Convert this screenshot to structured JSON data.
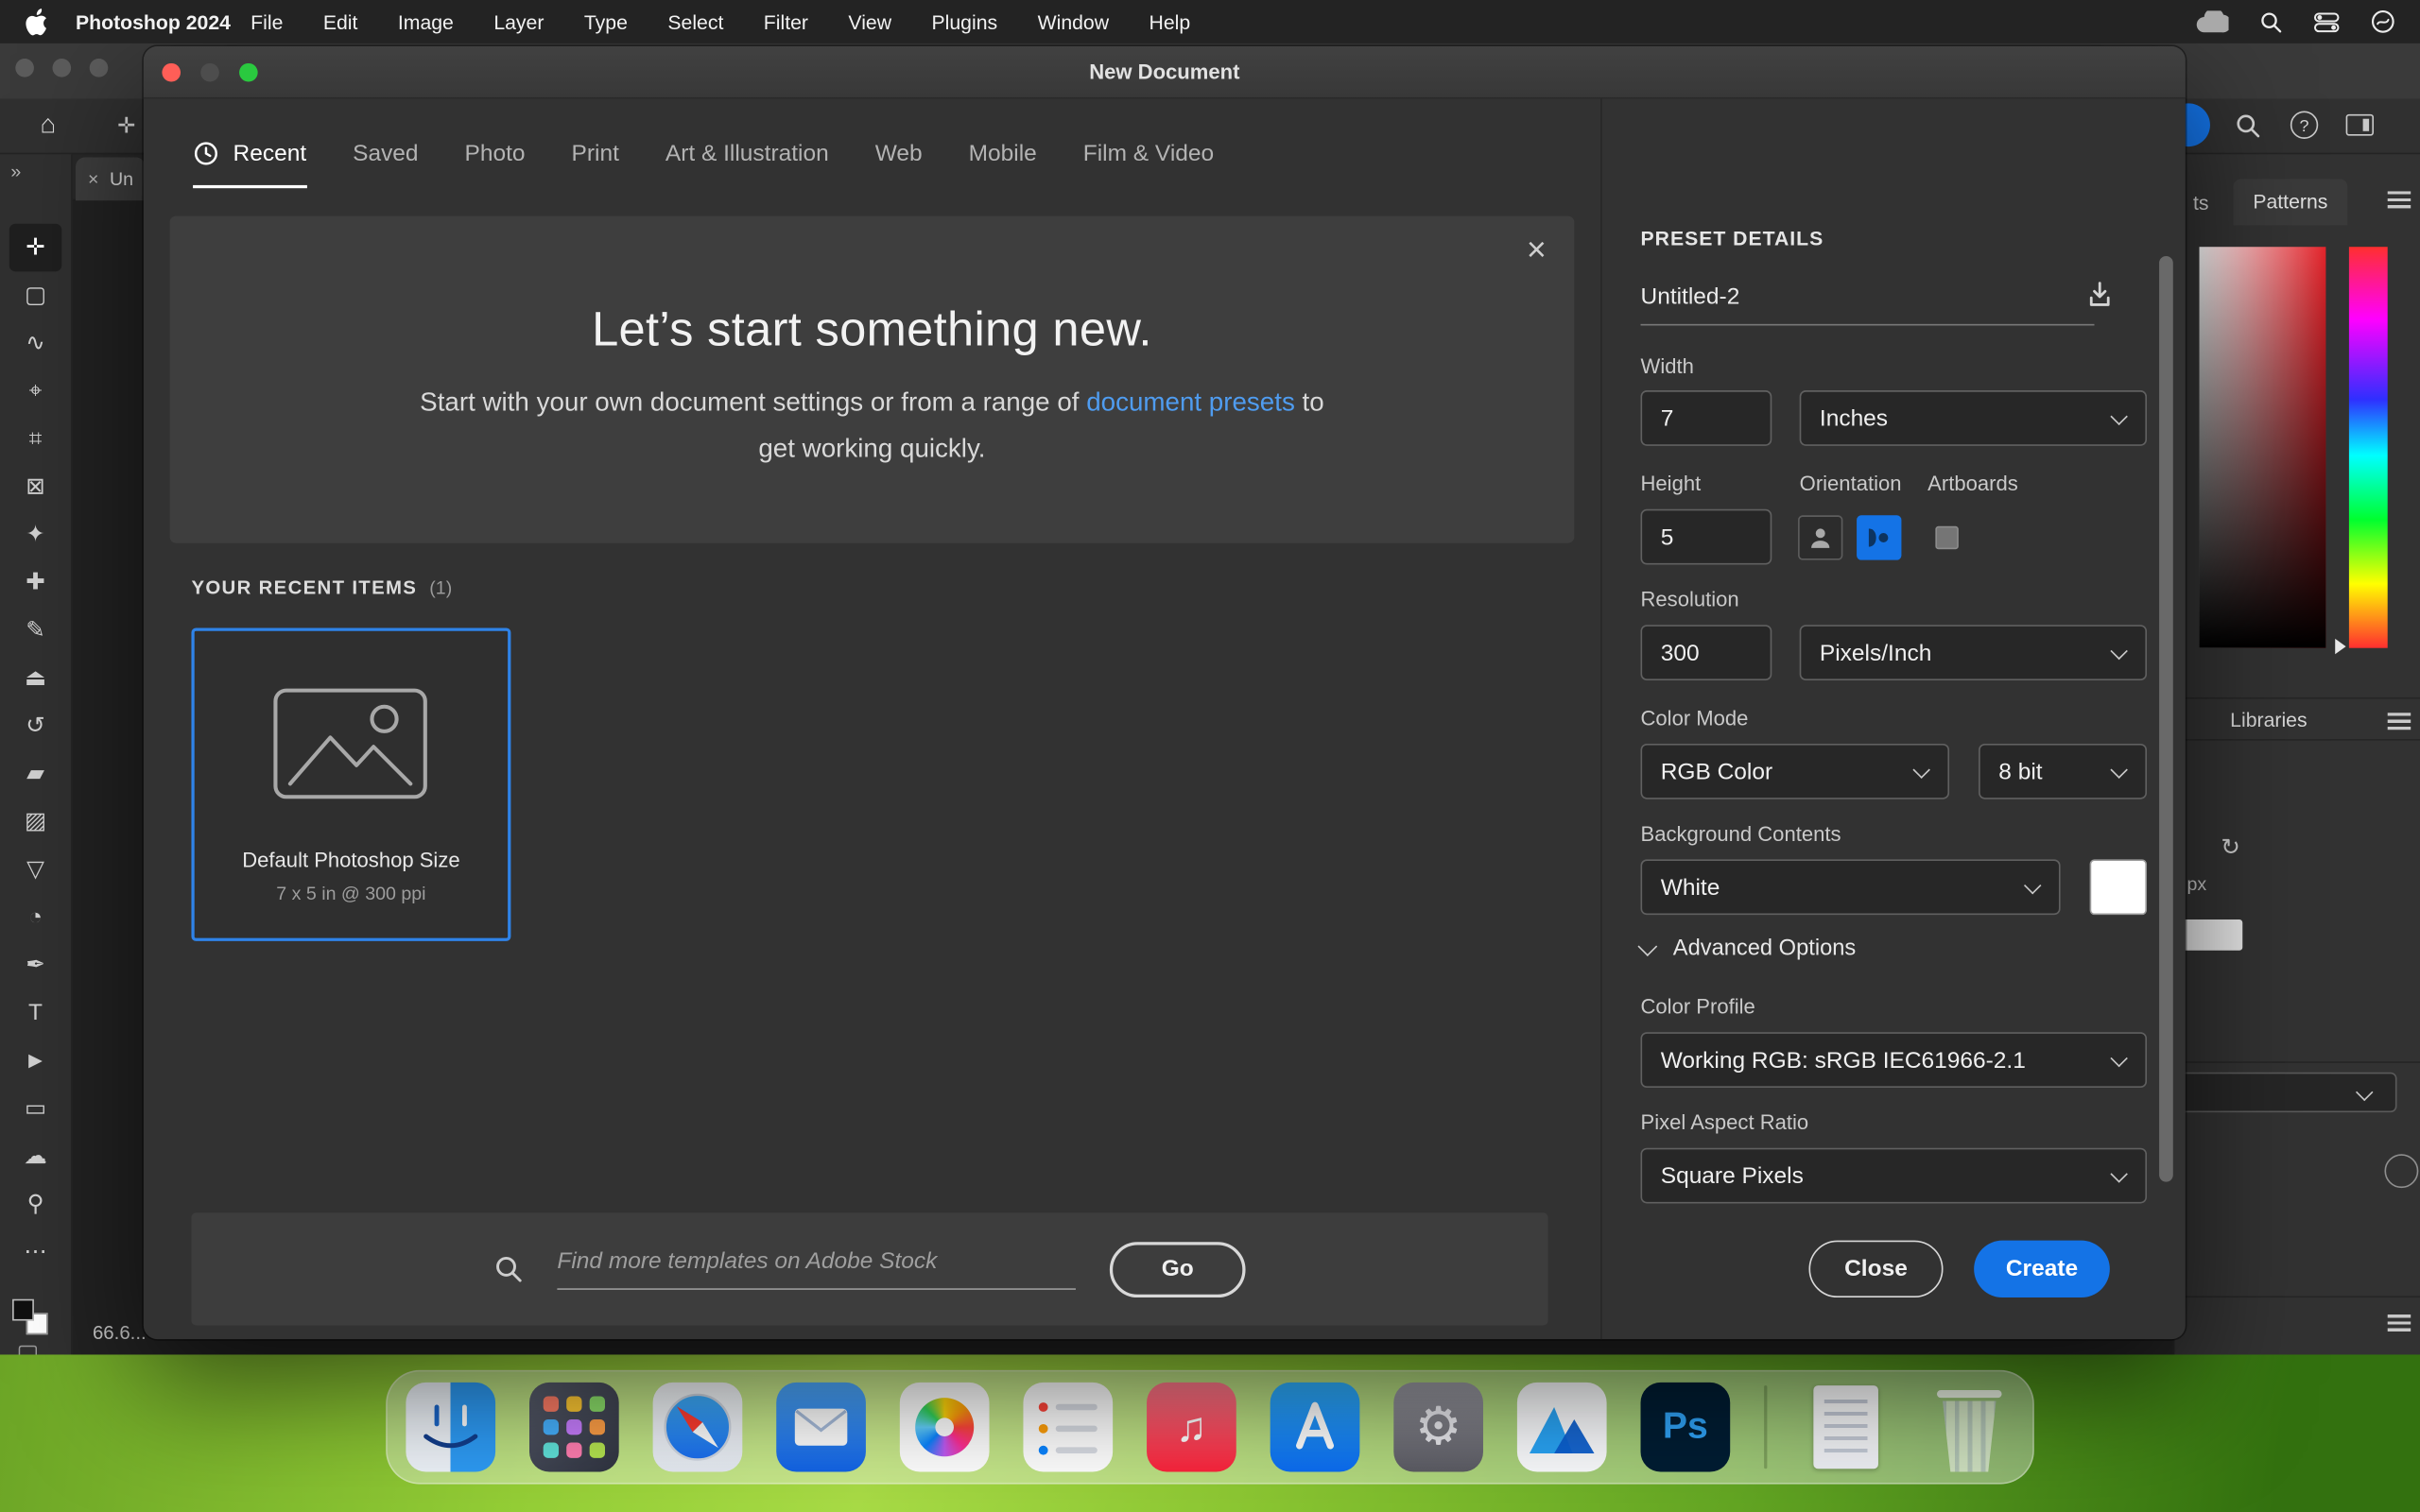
{
  "menu_bar": {
    "app_name": "Photoshop 2024",
    "items": [
      "File",
      "Edit",
      "Image",
      "Layer",
      "Type",
      "Select",
      "Filter",
      "View",
      "Plugins",
      "Window",
      "Help"
    ]
  },
  "photoshop": {
    "document_tab": "Un",
    "collapse_left": "»",
    "collapse_right": "»",
    "zoom_status": "66.6...",
    "options_bar": {
      "help": "?"
    },
    "right_panels": {
      "gradients_tab_partial": "ts",
      "patterns_tab": "Patterns",
      "libraries_tab": "Libraries",
      "px_label": "px"
    },
    "tools": [
      {
        "name": "move-tool",
        "glyph": "✛"
      },
      {
        "name": "marquee-tool",
        "glyph": "▢"
      },
      {
        "name": "lasso-tool",
        "glyph": "∿"
      },
      {
        "name": "object-selection-tool",
        "glyph": "⌖"
      },
      {
        "name": "crop-tool",
        "glyph": "⌗"
      },
      {
        "name": "frame-tool",
        "glyph": "⊠"
      },
      {
        "name": "eyedropper-tool",
        "glyph": "✦"
      },
      {
        "name": "healing-brush-tool",
        "glyph": "✚"
      },
      {
        "name": "brush-tool",
        "glyph": "✎"
      },
      {
        "name": "clone-stamp-tool",
        "glyph": "⏏"
      },
      {
        "name": "history-brush-tool",
        "glyph": "↺"
      },
      {
        "name": "eraser-tool",
        "glyph": "▰"
      },
      {
        "name": "gradient-tool",
        "glyph": "▨"
      },
      {
        "name": "blur-tool",
        "glyph": "▽"
      },
      {
        "name": "dodge-tool",
        "glyph": "◔"
      },
      {
        "name": "pen-tool",
        "glyph": "✒"
      },
      {
        "name": "type-tool",
        "glyph": "T"
      },
      {
        "name": "path-selection-tool",
        "glyph": "►"
      },
      {
        "name": "rectangle-tool",
        "glyph": "▭"
      },
      {
        "name": "hand-tool",
        "glyph": "☁"
      },
      {
        "name": "zoom-tool",
        "glyph": "⚲"
      },
      {
        "name": "edit-toolbar",
        "glyph": "⋯"
      }
    ]
  },
  "dialog": {
    "title": "New Document",
    "tabs": [
      "Recent",
      "Saved",
      "Photo",
      "Print",
      "Art & Illustration",
      "Web",
      "Mobile",
      "Film & Video"
    ],
    "active_tab_index": 0,
    "hero": {
      "title": "Let’s start something new.",
      "body_pre": "Start with your own document settings or from a range of ",
      "body_link": "document presets",
      "body_post": " to",
      "body_line2": "get working quickly.",
      "close_glyph": "×"
    },
    "recent_section": {
      "heading": "YOUR RECENT ITEMS",
      "count": "(1)"
    },
    "recent_items": [
      {
        "title": "Default Photoshop Size",
        "subtitle": "7 x 5 in @ 300 ppi"
      }
    ],
    "stock_search": {
      "placeholder": "Find more templates on Adobe Stock",
      "go_label": "Go"
    },
    "preset_details": {
      "heading": "PRESET DETAILS",
      "name_value": "Untitled-2",
      "width_label": "Width",
      "width_value": "7",
      "width_unit": "Inches",
      "height_label": "Height",
      "height_value": "5",
      "orientation_label": "Orientation",
      "artboards_label": "Artboards",
      "resolution_label": "Resolution",
      "resolution_value": "300",
      "resolution_unit": "Pixels/Inch",
      "color_mode_label": "Color Mode",
      "color_mode_value": "RGB Color",
      "bit_depth_value": "8 bit",
      "background_label": "Background Contents",
      "background_value": "White",
      "advanced_label": "Advanced Options",
      "color_profile_label": "Color Profile",
      "color_profile_value": "Working RGB: sRGB IEC61966-2.1",
      "pixel_aspect_label": "Pixel Aspect Ratio",
      "pixel_aspect_value": "Square Pixels",
      "close_label": "Close",
      "create_label": "Create"
    }
  },
  "dock": {
    "photoshop_label": "Ps",
    "apps": [
      "finder",
      "launchpad",
      "safari",
      "mail",
      "photos",
      "reminders",
      "music",
      "app-store",
      "system-settings",
      "mountains-app",
      "photoshop",
      "documents",
      "trash"
    ]
  },
  "colors": {
    "accent_blue": "#1473e6",
    "link_blue": "#4f9cf0",
    "selection_border": "#2f83e8",
    "dialog_bg": "#323232",
    "wallpaper_green": "#8cc732"
  }
}
